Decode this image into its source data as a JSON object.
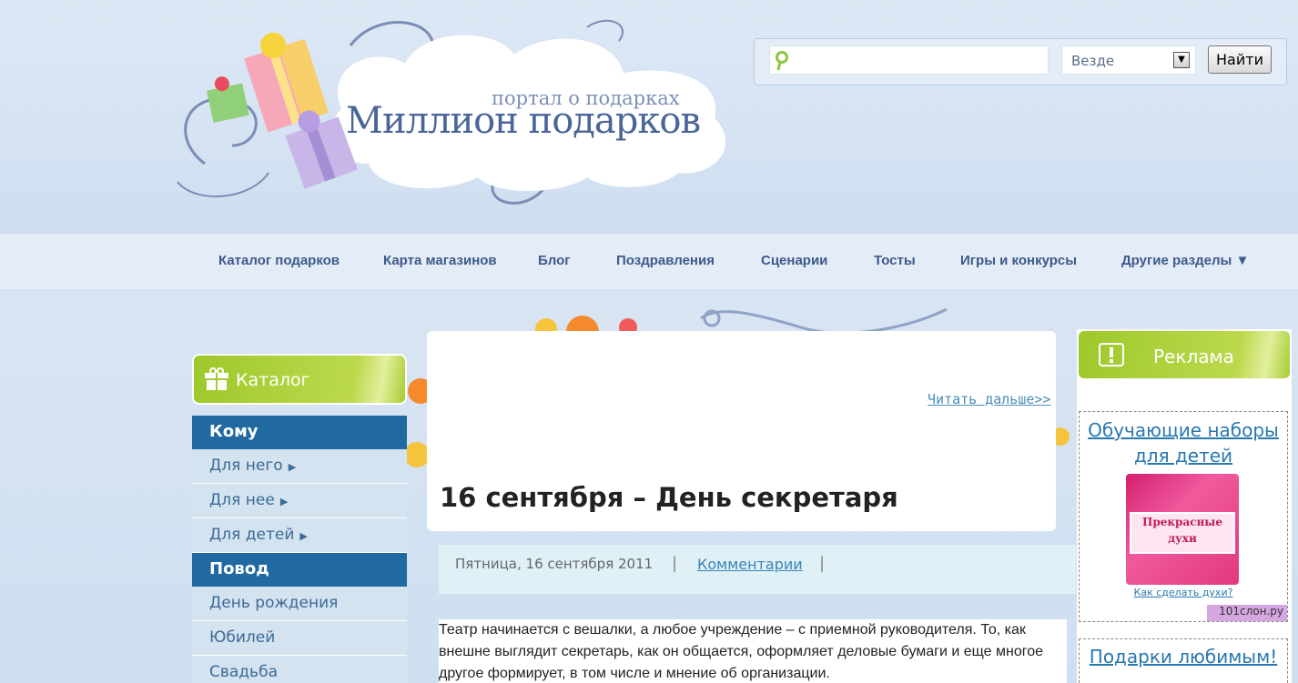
{
  "header": {
    "logo_subtitle": "портал о подарках",
    "logo_title": "Миллион подарков"
  },
  "search": {
    "placeholder": "",
    "scope_selected": "Везде",
    "button_label": "Найти"
  },
  "nav": {
    "items": [
      {
        "label": "Каталог подарков"
      },
      {
        "label": "Карта магазинов"
      },
      {
        "label": "Блог"
      },
      {
        "label": "Поздравления"
      },
      {
        "label": "Сценарии"
      },
      {
        "label": "Тосты"
      },
      {
        "label": "Игры и конкурсы"
      },
      {
        "label": "Другие разделы ▼"
      }
    ]
  },
  "catalog": {
    "title": "Каталог",
    "sections": [
      {
        "title": "Кому",
        "items": [
          "Для него",
          "Для нее",
          "Для детей"
        ]
      },
      {
        "title": "Повод",
        "items": [
          "День рождения",
          "Юбилей",
          "Свадьба"
        ]
      }
    ]
  },
  "article": {
    "read_more": "Читать дальше>>",
    "title": "16 сентября – День секретаря",
    "date": "Пятница, 16 сентября 2011",
    "comments": "Комментарии",
    "body": "Театр начинается с вешалки, а любое учреждение – с приемной руководителя. То, как внешне выглядит секретарь, как он общается, оформляет деловые бумаги и еще многое другое формирует, в том числе и мнение об организации."
  },
  "ads": {
    "title": "Реклама",
    "ad1_title": "Обучающие наборы для детей",
    "ad1_image_text": "Прекрасные духи",
    "ad1_caption": "Как сделать духи?",
    "ad1_brand": "101слон.ру",
    "ad2_title": "Подарки любимым!"
  },
  "colors": {
    "nav_text": "#3d5a8a",
    "catalog_section": "#2069a1",
    "catalog_item_bg": "#d3e3f0",
    "green_header": "#9ec82b",
    "link": "#2a78b0"
  }
}
